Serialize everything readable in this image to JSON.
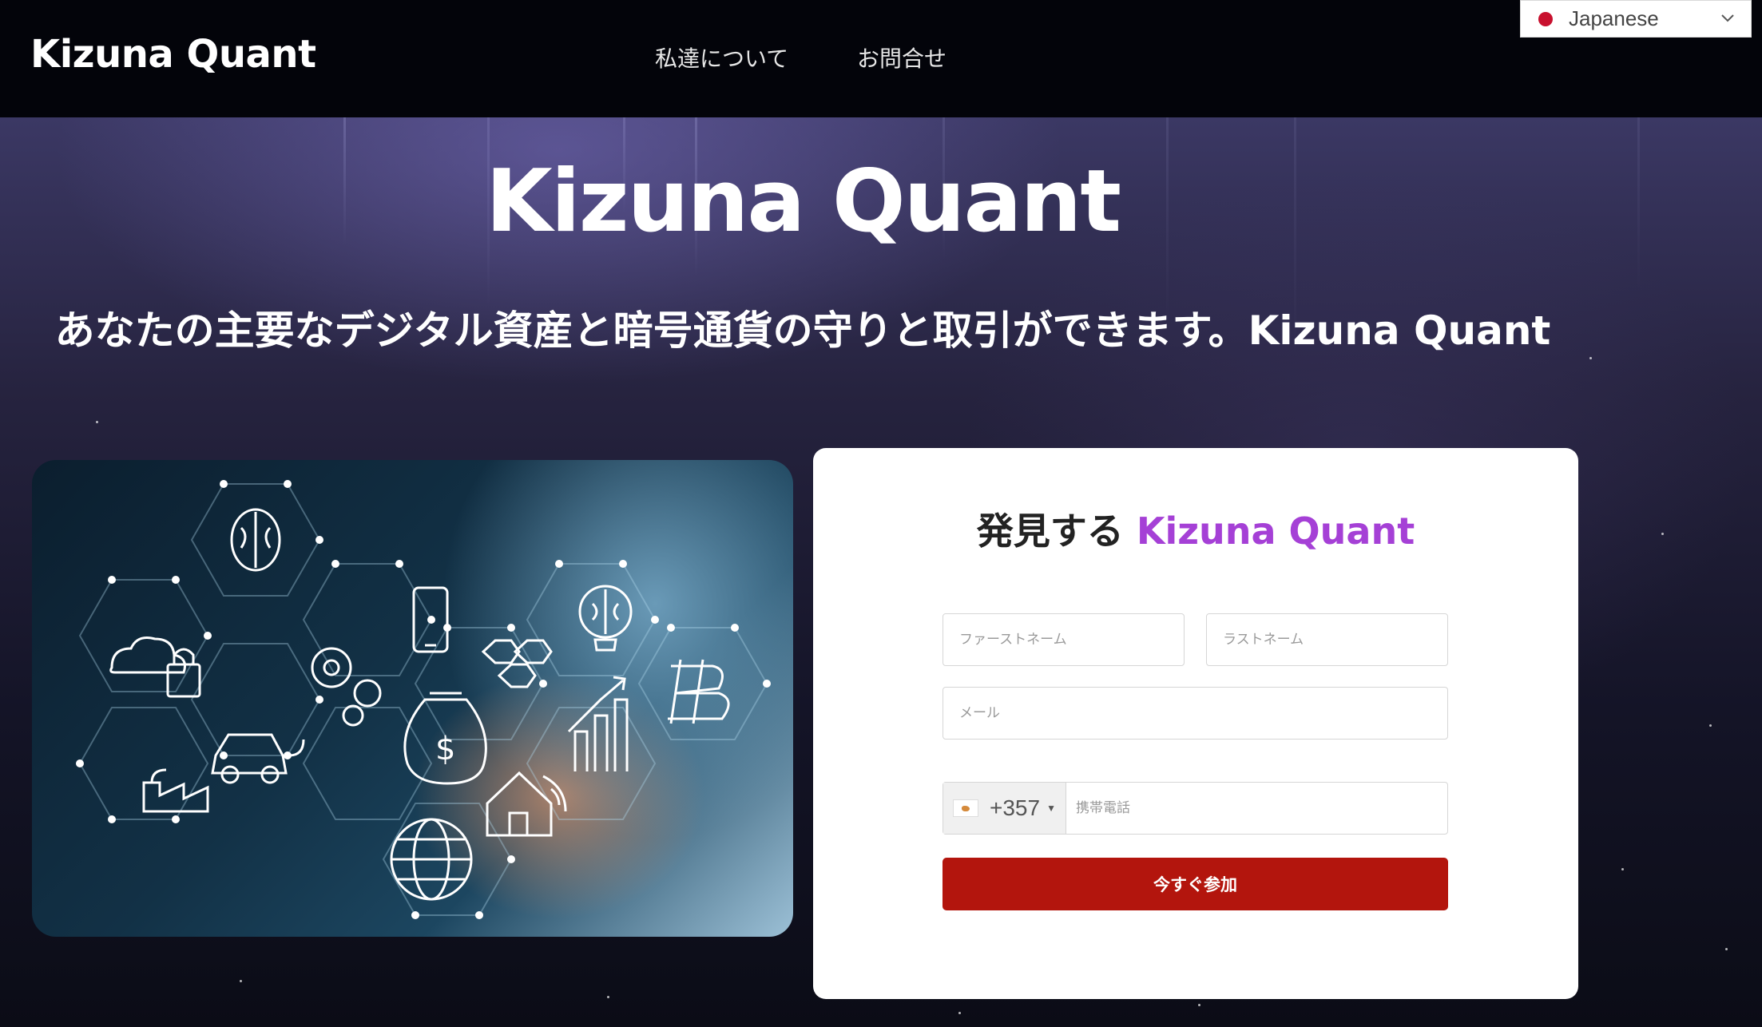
{
  "header": {
    "logo": "Kizuna Quant",
    "nav": [
      {
        "label": "私達について"
      },
      {
        "label": "お問合せ"
      }
    ],
    "language": {
      "selected": "Japanese",
      "flag_color": "#c8102e"
    }
  },
  "hero": {
    "title": "Kizuna Quant",
    "subtitle": "あなたの主要なデジタル資産と暗号通貨の守りと取引ができます。Kizuna Quant"
  },
  "illustration": {
    "icons": [
      "brain-icon",
      "smartphone-icon",
      "cloud-lock-icon",
      "gears-icon",
      "car-charging-icon",
      "money-bag-icon",
      "hexagon-grid-icon",
      "growth-chart-icon",
      "bitcoin-icon",
      "factory-icon",
      "smart-home-icon",
      "globe-icon",
      "lightbulb-brain-icon"
    ]
  },
  "form": {
    "title_prefix": "発見する",
    "title_brand": "Kizuna Quant",
    "accent_color": "#a540d6",
    "first_name_placeholder": "ファーストネーム",
    "last_name_placeholder": "ラストネーム",
    "email_placeholder": "メール",
    "dial_code": "+357",
    "phone_placeholder": "携帯電話",
    "submit_label": "今すぐ参加",
    "submit_color": "#b3150d"
  }
}
